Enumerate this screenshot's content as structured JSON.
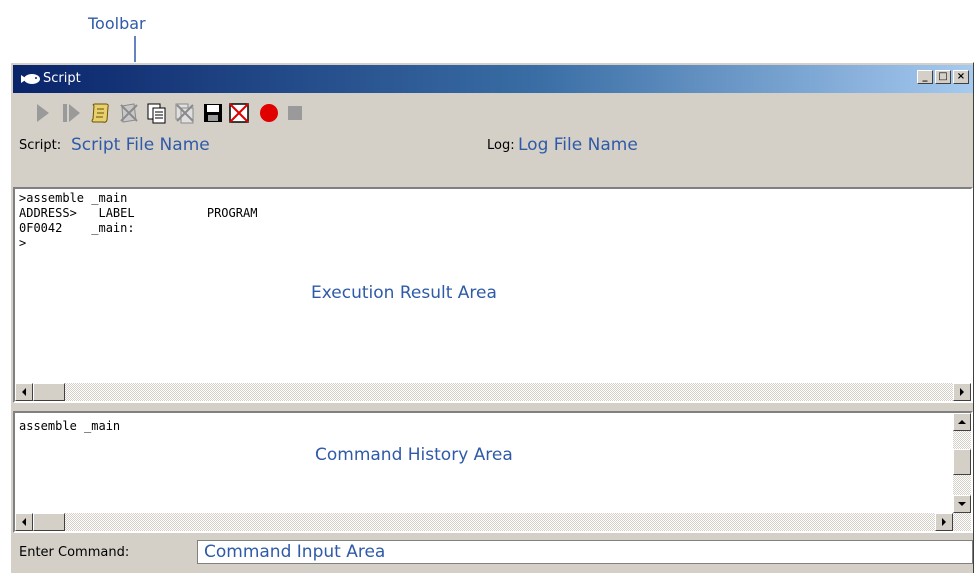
{
  "annotations": {
    "toolbar_callout": "Toolbar",
    "script_file_name": "Script File Name",
    "log_file_name": "Log File Name",
    "execution_result_area": "Execution Result Area",
    "command_history_area": "Command History Area",
    "command_input_area": "Command Input Area"
  },
  "window": {
    "title": "Script",
    "minimize": "_",
    "maximize": "□",
    "close": "×"
  },
  "toolbar": {
    "buttons": [
      {
        "icon": "run-icon",
        "enabled": false
      },
      {
        "icon": "step-run-icon",
        "enabled": false
      },
      {
        "icon": "open-script-icon",
        "enabled": true
      },
      {
        "icon": "close-script-icon",
        "enabled": false
      },
      {
        "icon": "view-log-icon",
        "enabled": true
      },
      {
        "icon": "clear-log-icon",
        "enabled": false
      },
      {
        "icon": "save-icon",
        "enabled": true
      },
      {
        "icon": "clear-icon",
        "enabled": true
      },
      {
        "icon": "record-icon",
        "enabled": true
      },
      {
        "icon": "stop-icon",
        "enabled": false
      }
    ]
  },
  "fileinfo": {
    "script_label": "Script:",
    "log_label": "Log:"
  },
  "execution_result": {
    "lines": [
      ">assemble _main",
      "ADDRESS>   LABEL          PROGRAM",
      "0F0042    _main:",
      ">"
    ]
  },
  "command_history": {
    "lines": [
      "assemble _main"
    ]
  },
  "command": {
    "label": "Enter Command:"
  },
  "colors": {
    "annotation_blue": "#2f5aa8",
    "title_gradient_start": "#0a246a",
    "face": "#d4d0c8",
    "record_red": "#e00000"
  }
}
